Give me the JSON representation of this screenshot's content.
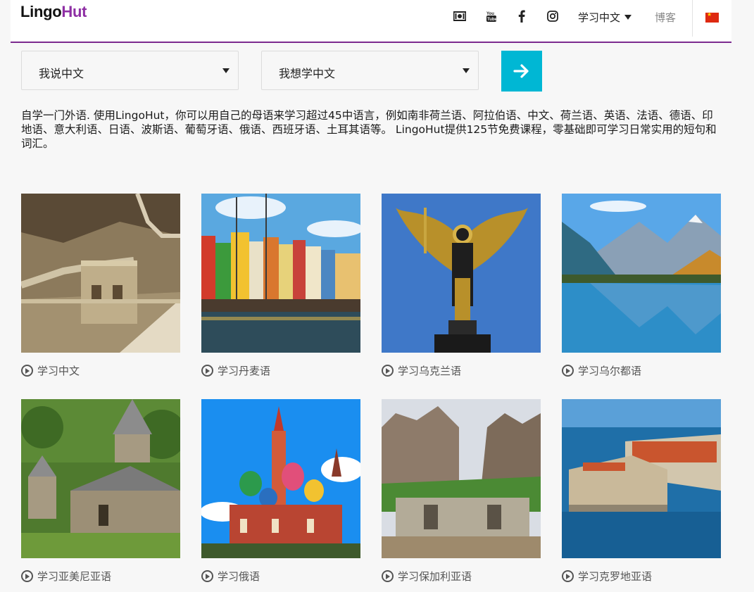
{
  "header": {
    "logo_part1": "Lingo",
    "logo_part2": "Hut",
    "icons": [
      "money-icon",
      "youtube-icon",
      "facebook-icon",
      "instagram-icon"
    ],
    "lang_menu": "学习中文",
    "blog": "博客",
    "flag": "china-flag-icon",
    "accent": "#7b2a8e"
  },
  "selectors": {
    "speak": "我说中文",
    "learn": "我想学中文",
    "go_color": "#00b7d4"
  },
  "intro": "自学一门外语. 使用LingoHut，你可以用自己的母语来学习超过45中语言，例如南非荷兰语、阿拉伯语、中文、荷兰语、英语、法语、德语、印地语、意大利语、日语、波斯语、葡萄牙语、俄语、西班牙语、土耳其语等。 LingoHut提供125节免费课程，零基础即可学习日常实用的短句和词汇。",
  "courses": [
    {
      "label": "学习中文",
      "image": "great-wall"
    },
    {
      "label": "学习丹麦语",
      "image": "copenhagen-nyhavn"
    },
    {
      "label": "学习乌克兰语",
      "image": "archangel-statue"
    },
    {
      "label": "学习乌尔都语",
      "image": "mountain-lake"
    },
    {
      "label": "学习亚美尼亚语",
      "image": "armenian-monastery"
    },
    {
      "label": "学习俄语",
      "image": "st-basils-cathedral"
    },
    {
      "label": "学习保加利亚语",
      "image": "belogradchik-fortress"
    },
    {
      "label": "学习克罗地亚语",
      "image": "dubrovnik"
    }
  ]
}
